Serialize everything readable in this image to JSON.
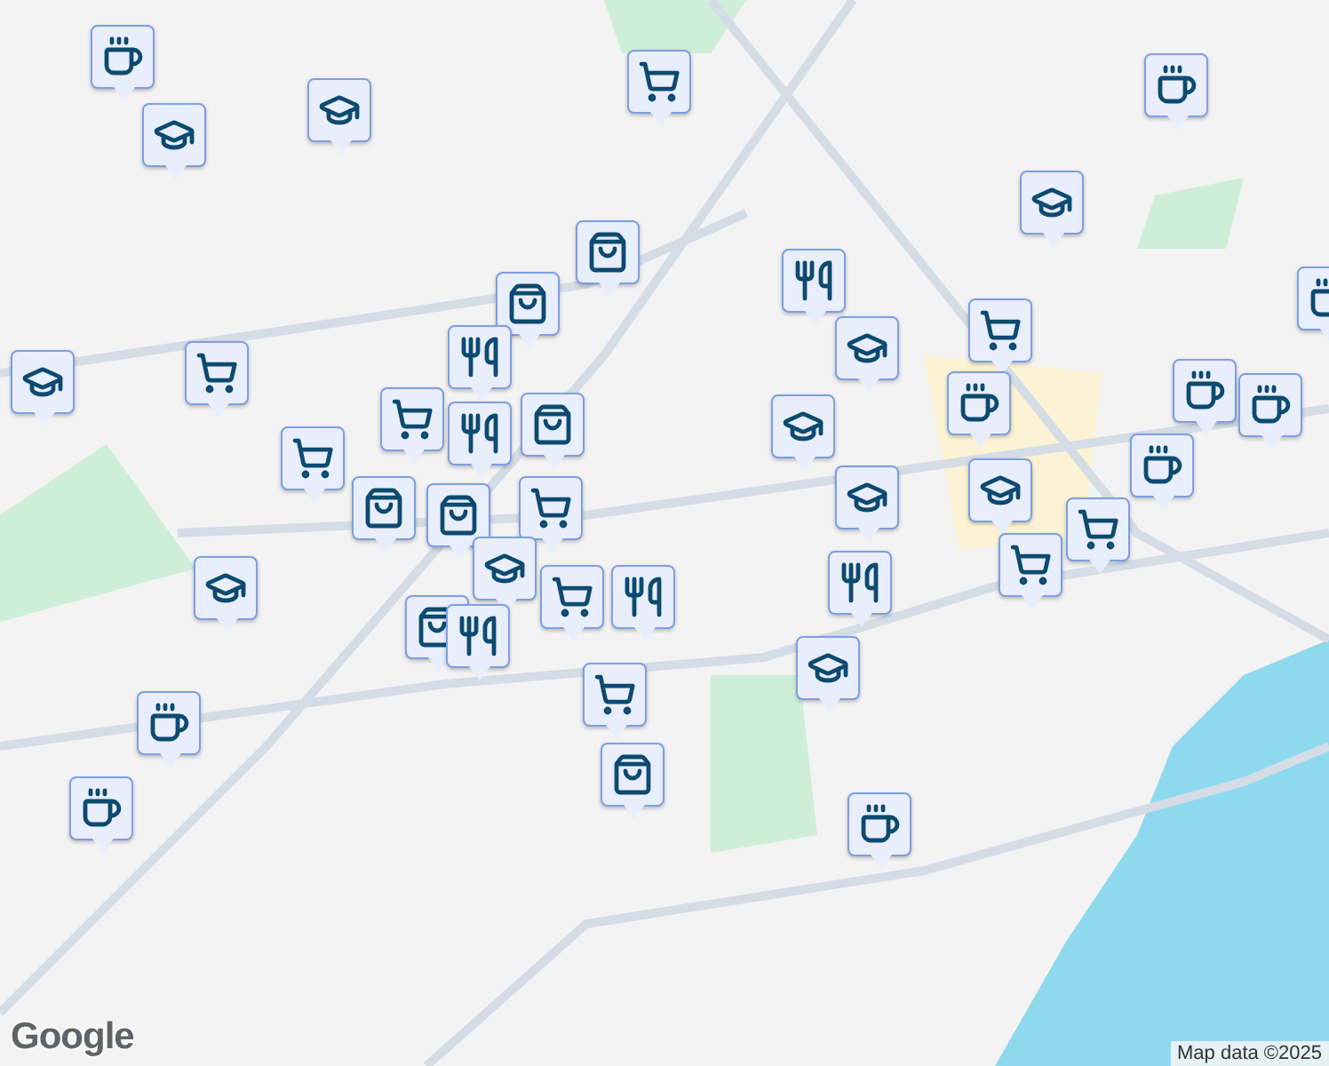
{
  "map": {
    "pins": [
      {
        "kind": "coffee"
      },
      {
        "kind": "school"
      },
      {
        "kind": "school"
      },
      {
        "kind": "cart"
      },
      {
        "kind": "coffee"
      },
      {
        "kind": "school"
      },
      {
        "kind": "bag"
      },
      {
        "kind": "bag"
      },
      {
        "kind": "food"
      },
      {
        "kind": "food"
      },
      {
        "kind": "school"
      },
      {
        "kind": "coffee"
      },
      {
        "kind": "cart"
      },
      {
        "kind": "cart"
      },
      {
        "kind": "school"
      },
      {
        "kind": "school"
      },
      {
        "kind": "coffee"
      },
      {
        "kind": "coffee"
      },
      {
        "kind": "coffee"
      },
      {
        "kind": "bag"
      },
      {
        "kind": "cart"
      },
      {
        "kind": "food"
      },
      {
        "kind": "cart"
      },
      {
        "kind": "school"
      },
      {
        "kind": "coffee"
      },
      {
        "kind": "cart"
      },
      {
        "kind": "bag"
      },
      {
        "kind": "bag"
      },
      {
        "kind": "school"
      },
      {
        "kind": "food"
      },
      {
        "kind": "cart"
      },
      {
        "kind": "cart"
      },
      {
        "kind": "school"
      },
      {
        "kind": "school"
      },
      {
        "kind": "cart"
      },
      {
        "kind": "food"
      },
      {
        "kind": "bag"
      },
      {
        "kind": "food"
      },
      {
        "kind": "school"
      },
      {
        "kind": "cart"
      },
      {
        "kind": "coffee"
      },
      {
        "kind": "bag"
      },
      {
        "kind": "coffee"
      },
      {
        "kind": "coffee"
      }
    ]
  },
  "logo": "Google",
  "attribution": "Map data ©2025"
}
